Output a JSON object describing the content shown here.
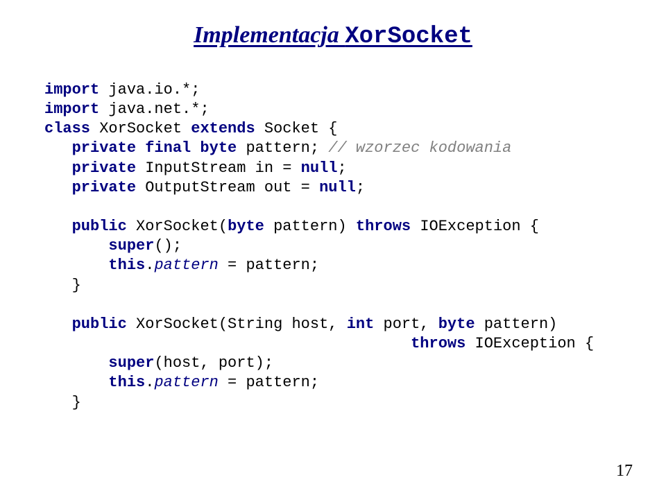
{
  "title": {
    "part1": "Implementacja ",
    "part2": "XorSocket"
  },
  "code": {
    "l01a": "import",
    "l01b": " java.io.*;",
    "l02a": "import",
    "l02b": " java.net.*;",
    "l03a": "class",
    "l03b": " XorSocket ",
    "l03c": "extends",
    "l03d": " Socket {",
    "l04a": "   private final byte",
    "l04b": " pattern; ",
    "l04c": "// wzorzec kodowania",
    "l05a": "   private",
    "l05b": " InputStream in = ",
    "l05c": "null",
    "l05d": ";",
    "l06a": "   private",
    "l06b": " OutputStream out = ",
    "l06c": "null",
    "l06d": ";",
    "l07": "",
    "l08a": "   public",
    "l08b": " XorSocket(",
    "l08c": "byte",
    "l08d": " pattern) ",
    "l08e": "throws",
    "l08f": " IOException {",
    "l09a": "       super",
    "l09b": "();",
    "l10a": "       this",
    "l10b": ".",
    "l10c": "pattern",
    "l10d": " = pattern;",
    "l11": "   }",
    "l12": "",
    "l13a": "   public",
    "l13b": " XorSocket(String host, ",
    "l13c": "int",
    "l13d": " port, ",
    "l13e": "byte",
    "l13f": " pattern)",
    "l14a": "                                        throws",
    "l14b": " IOException {",
    "l15a": "       super",
    "l15b": "(host, port);",
    "l16a": "       this",
    "l16b": ".",
    "l16c": "pattern",
    "l16d": " = pattern;",
    "l17": "   }"
  },
  "pagenum": "17"
}
